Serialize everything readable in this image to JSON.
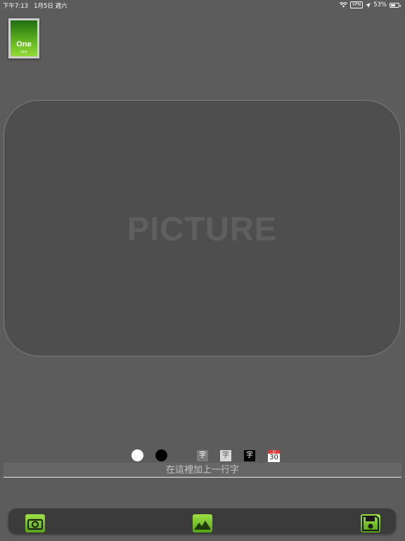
{
  "status_bar": {
    "time": "下午7:13",
    "date": "1月5日 週六",
    "vpn": "VPN",
    "battery": "53%"
  },
  "logo": {
    "title": "One",
    "subtitle": "Line"
  },
  "picture": {
    "placeholder": "PICTURE"
  },
  "text_styles": {
    "gray": "字",
    "light": "字",
    "black": "字"
  },
  "calendar": {
    "month": "12",
    "day": "30"
  },
  "caption": {
    "placeholder": "在這裡加上一行字"
  },
  "colors": {
    "background": "#5c5c5c",
    "accent": "#7bc42c",
    "toolbar": "#3b3b3b"
  },
  "toolbar": {
    "icons": [
      "camera-icon",
      "gallery-icon",
      "save-icon"
    ]
  }
}
